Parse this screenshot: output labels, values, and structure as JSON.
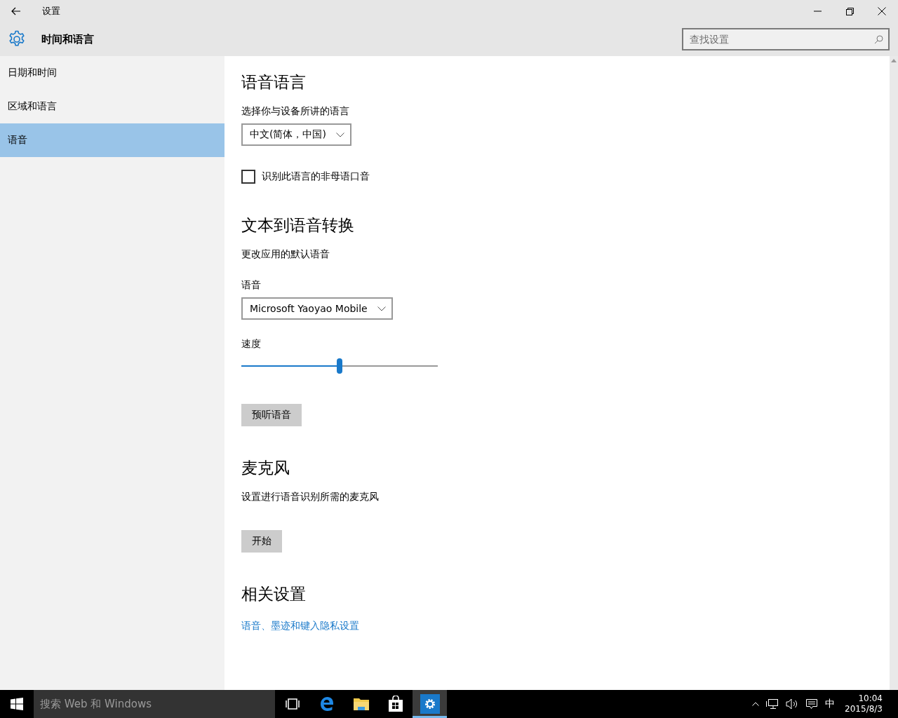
{
  "window": {
    "title": "设置"
  },
  "header": {
    "title": "时间和语言"
  },
  "search": {
    "placeholder": "查找设置"
  },
  "sidebar": {
    "items": [
      {
        "label": "日期和时间",
        "selected": false
      },
      {
        "label": "区域和语言",
        "selected": false
      },
      {
        "label": "语音",
        "selected": true
      }
    ]
  },
  "content": {
    "blocks": [
      {
        "kind": "heading",
        "text": "语音语言"
      },
      {
        "kind": "text",
        "text": "选择你与设备所讲的语言"
      },
      {
        "kind": "dropdown",
        "value": "中文(简体，中国)"
      },
      {
        "kind": "checkbox",
        "label": "识别此语言的非母语口音",
        "checked": false
      },
      {
        "kind": "heading",
        "text": "文本到语音转换"
      },
      {
        "kind": "text",
        "text": "更改应用的默认语音"
      },
      {
        "kind": "label",
        "text": "语音"
      },
      {
        "kind": "dropdown",
        "value": "Microsoft Yaoyao Mobile"
      },
      {
        "kind": "label",
        "text": "速度"
      },
      {
        "kind": "slider",
        "level": 0.5
      },
      {
        "kind": "button",
        "text": "预听语音"
      },
      {
        "kind": "heading",
        "text": "麦克风"
      },
      {
        "kind": "text",
        "text": "设置进行语音识别所需的麦克风"
      },
      {
        "kind": "button",
        "text": "开始"
      },
      {
        "kind": "heading",
        "text": "相关设置"
      },
      {
        "kind": "link",
        "text": "语音、墨迹和键入隐私设置"
      }
    ]
  },
  "taskbar": {
    "search_placeholder": "搜索 Web 和 Windows",
    "apps": [
      {
        "kind": "task-view",
        "selected": false
      },
      {
        "kind": "browser",
        "selected": false
      },
      {
        "kind": "folder",
        "selected": false
      },
      {
        "kind": "store",
        "selected": false
      },
      {
        "kind": "settings",
        "selected": true
      }
    ],
    "tray": {
      "ime": "中",
      "time": "10:04",
      "date": "2015/8/3"
    }
  }
}
